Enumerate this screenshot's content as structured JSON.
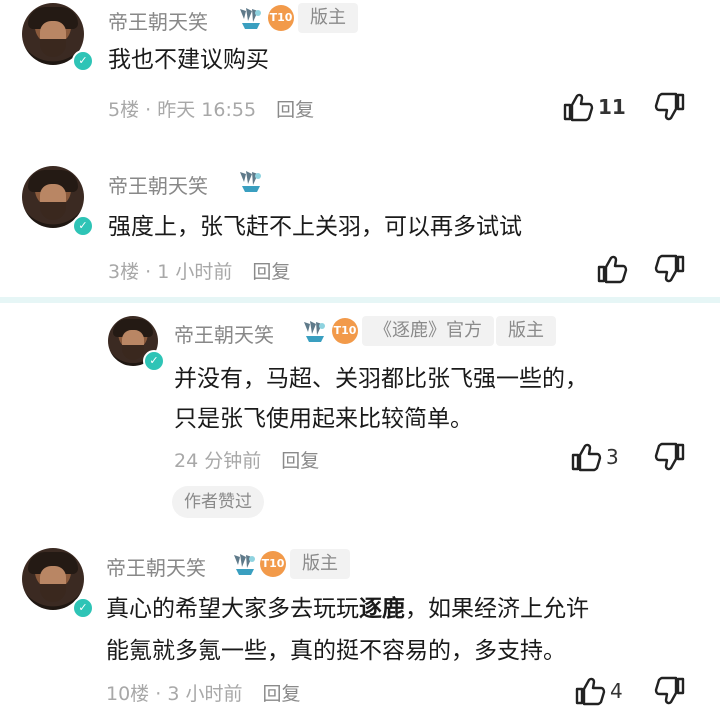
{
  "comments": [
    {
      "user": "帝王朝天笑",
      "level": "T10",
      "role_tag": "版主",
      "text": "我也不建议购买",
      "floor": "5楼",
      "time": "昨天 16:55",
      "reply": "回复",
      "likes": "11"
    },
    {
      "user": "帝王朝天笑",
      "text": "强度上，张飞赶不上关羽，可以再多试试",
      "floor": "3楼",
      "time": "1 小时前",
      "reply": "回复",
      "likes": ""
    },
    {
      "user": "帝王朝天笑",
      "level": "T10",
      "official_tag": "《逐鹿》官方",
      "role_tag": "版主",
      "text_line1": "并没有，马超、关羽都比张飞强一些的，",
      "text_line2": "只是张飞使用起来比较简单。",
      "time": "24 分钟前",
      "reply": "回复",
      "likes": "3",
      "author_liked": "作者赞过"
    },
    {
      "user": "帝王朝天笑",
      "level": "T10",
      "role_tag": "版主",
      "text_line1_pre": "真心的希望大家多去玩玩",
      "text_line1_bold": "逐鹿",
      "text_line1_post": "，如果经济上允许",
      "text_line2": "能氪就多氪一些，真的挺不容易的，多支持。",
      "floor": "10楼",
      "time": "3 小时前",
      "reply": "回复",
      "likes": "4"
    }
  ],
  "separator": "·",
  "icons": {
    "like": "thumbs-up-icon",
    "dislike": "thumbs-down-icon",
    "verified": "check-icon",
    "fan_badge": "fan-badge-icon"
  },
  "colors": {
    "name": "#888888",
    "meta": "#a8a8a8",
    "verified": "#2ec4b6",
    "level_badge": "#f29a4a",
    "divider": "#e6f6f6"
  }
}
